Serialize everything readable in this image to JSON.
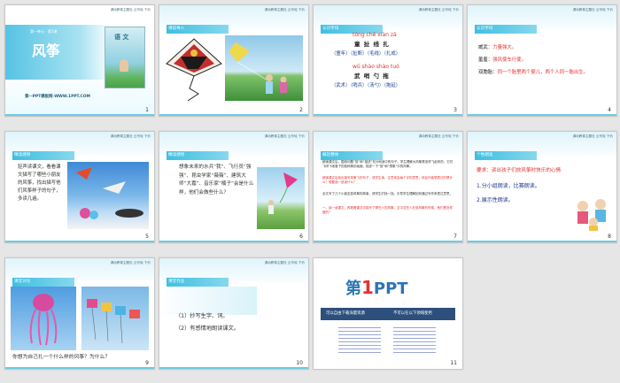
{
  "header_right": "调动教育主题社 云写轮 下价",
  "slides": {
    "s1": {
      "unit": "第一单元 · 第2课",
      "title": "风筝",
      "book": "语 文",
      "footer": "第一PPT模板网-WWW.1PPT.COM",
      "num": "1"
    },
    "s2": {
      "label": "课前导入",
      "num": "2"
    },
    "s3": {
      "label": "认识字词",
      "p1": "tóng chě xiàn zā",
      "c1": "童 扯 线 扎",
      "r1": "（童年）（扯断）（毛线）（扎成）",
      "p2": "wǔ shào shào tuó",
      "c2": "武 哨 勺 拖",
      "r2": "（武术）（哨兵）（汤勺）（拖延）",
      "num": "3"
    },
    "s4": {
      "label": "认识字词",
      "l1a": "威武：",
      "l1b": "力量强大。",
      "l2a": "羞羞：",
      "l2b": "强风使车行使。",
      "l3a": "双胞胎：",
      "l3b": "同一个胎里两个婴儿，两个人同一胎出生。",
      "num": "4"
    },
    "s5": {
      "label": "精读感悟",
      "text": "轻声读课文，看看课文描写了哪些小朋友的风筝，找出描写他们风筝样子的句子，多读几遍。",
      "num": "5"
    },
    "s6": {
      "label": "精读感悟",
      "text": "想象未来的水兵“我”、飞行员“强强”、昆虫学家“薇薇”、建筑大师“大嘉”、音乐家“楠子”会是什么样，他们会做些什么？",
      "num": "6"
    },
    "s7": {
      "label": "概括整体",
      "p1": "朗读课文后，围绕问题“放”和“描述”充分地读中的句子。学生理解大风筝是怎样飞起来的，它们飞呀飞地落下的各种美妙画面。描述一下“放”和“想象”中的风筝。",
      "p2": "朗读课文后找出描写风筝飞的句子，请学生读，注意体会每个字的意思。体会作者想表达的是什么？想要追一追读什么？",
      "p3": "全文写了几个小朋友放风筝的故事，请学生们找一找。引导学生理解如何通过写作来表达意思。",
      "p4": "一、读一读课文，再看看课文中描写了哪些人的风筝。文中这些人在放风筝的时候，他们是怎样做的？",
      "num": "7"
    },
    "s8": {
      "label": "个性朗读",
      "req": "要求：读出孩子们放风筝时快乐的心情",
      "i1": "1.分小组朗读，比赛朗读。",
      "i2": "2.展示性朗读。",
      "num": "8"
    },
    "s9": {
      "label": "课堂讨论",
      "q": "你想为自己扎一个什么样的风筝？为什么？",
      "num": "9"
    },
    "s10": {
      "label": "课堂作业",
      "i1": "（1）抄写生字、词。",
      "i2": "（2）有感情地朗读课文。",
      "num": "10"
    },
    "s11": {
      "logo_a": "第",
      "logo_b": "1",
      "logo_c": "PPT",
      "t1": "可以自由下载海量资源",
      "t2": "不可以在以下领域使用",
      "num": "11"
    }
  }
}
